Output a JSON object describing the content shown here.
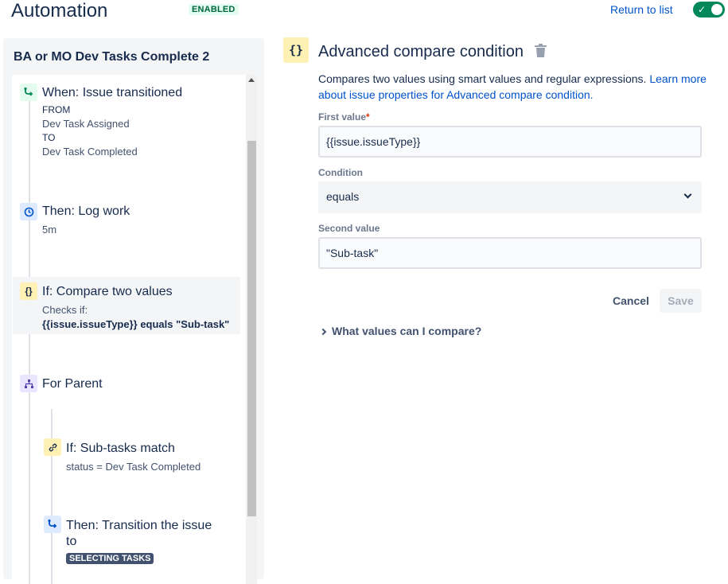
{
  "header": {
    "title": "Automation",
    "status_badge": "ENABLED",
    "return_link": "Return to list",
    "toggle_on": true
  },
  "rule": {
    "name": "BA or MO Dev Tasks Complete 2",
    "steps": [
      {
        "icon": "transition-icon",
        "title": "When: Issue transitioned",
        "from_label": "FROM",
        "from_value": "Dev Task Assigned",
        "to_label": "TO",
        "to_value": "Dev Task Completed"
      },
      {
        "icon": "clock-icon",
        "title": "Then: Log work",
        "detail": "5m"
      },
      {
        "icon": "braces-icon",
        "title": "If: Compare two values",
        "detail": "Checks if:",
        "detail_bold": "{{issue.issueType}} equals \"Sub-task\""
      },
      {
        "icon": "hierarchy-icon",
        "title": "For Parent"
      },
      {
        "icon": "link-icon",
        "title": "If: Sub-tasks match",
        "detail": "status = Dev Task Completed"
      },
      {
        "icon": "transition-icon",
        "title_line1": "Then: Transition the issue",
        "title_line2": "to",
        "status": "SELECTING TASKS"
      }
    ]
  },
  "condition": {
    "icon_glyph": "{}",
    "title": "Advanced compare condition",
    "description": "Compares two values using smart values and regular expressions.",
    "learn_more_link": "Learn more about issue properties for Advanced compare condition.",
    "first_value_label": "First value",
    "first_value": "{{issue.issueType}}",
    "condition_label": "Condition",
    "condition_value": "equals",
    "second_value_label": "Second value",
    "second_value": "\"Sub-task\"",
    "cancel_label": "Cancel",
    "save_label": "Save",
    "expander_label": "What values can I compare?"
  },
  "colors": {
    "primary": "#0052cc",
    "toggle": "#00875a",
    "text": "#172b4d"
  }
}
